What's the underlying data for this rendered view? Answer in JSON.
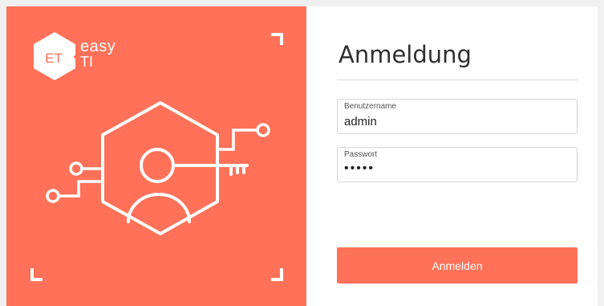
{
  "branding": {
    "logo_badge": "ET",
    "logo_line1": "easy",
    "logo_line2": "TI",
    "accent_color": "#ff7158"
  },
  "form": {
    "title": "Anmeldung",
    "username": {
      "label": "Benutzername",
      "value": "admin"
    },
    "password": {
      "label": "Passwort",
      "value": "•••••"
    },
    "submit_label": "Anmelden"
  },
  "icons": [
    "logo-hexagon-icon",
    "user-key-hexagon-icon",
    "corner-bracket-icon",
    "circuit-line-icon"
  ]
}
